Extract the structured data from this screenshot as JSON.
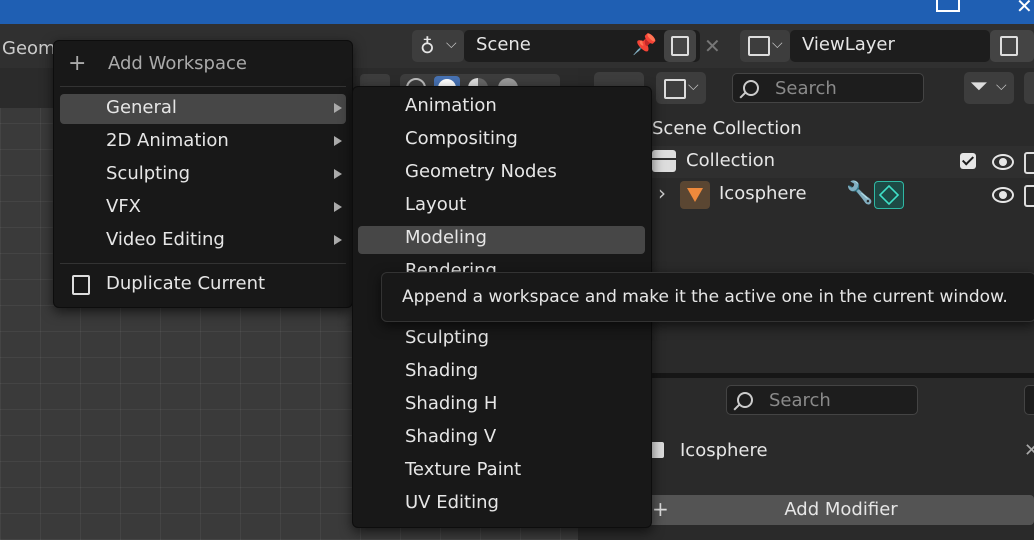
{
  "title_bar": {
    "color": "#1f5fb3"
  },
  "workspace_tab": {
    "label": "Geom"
  },
  "scene": {
    "label": "Scene"
  },
  "view_layer": {
    "label": "ViewLayer"
  },
  "outliner": {
    "search_placeholder": "Search",
    "scene_collection": "Scene Collection",
    "collection": "Collection",
    "object": "Icosphere"
  },
  "properties": {
    "search_placeholder": "Search",
    "object_name": "Icosphere",
    "add_modifier": "Add Modifier"
  },
  "add_workspace_menu": {
    "title": "Add Workspace",
    "items": [
      "General",
      "2D Animation",
      "Sculpting",
      "VFX",
      "Video Editing"
    ],
    "duplicate": "Duplicate Current"
  },
  "general_submenu": {
    "items": [
      "Animation",
      "Compositing",
      "Geometry Nodes",
      "Layout",
      "Modeling",
      "Rendering",
      "Sculpting",
      "Shading",
      "Shading H",
      "Shading V",
      "Texture Paint",
      "UV Editing"
    ],
    "highlighted": "Modeling"
  },
  "tooltip": {
    "text": "Append a workspace and make it the active one in the current window."
  },
  "colors": {
    "accent": "#4772b3",
    "highlight": "#474747",
    "menu_bg": "#181818"
  }
}
